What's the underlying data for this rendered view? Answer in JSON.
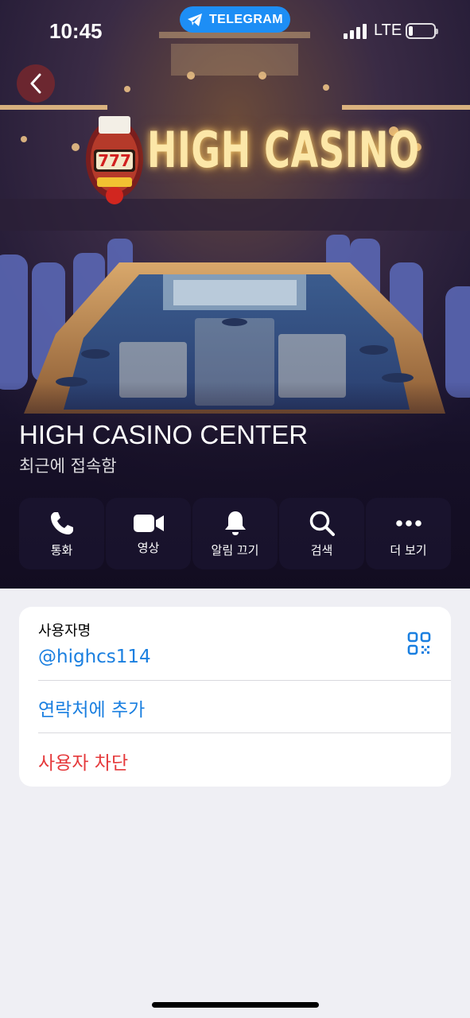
{
  "status_bar": {
    "time": "10:45",
    "app_pill": "TELEGRAM",
    "network": "LTE"
  },
  "banner": {
    "logo_text": "HIGH CASINO"
  },
  "profile": {
    "name": "HIGH CASINO CENTER",
    "status": "최근에 접속함"
  },
  "actions": [
    {
      "label": "통화",
      "icon": "phone-icon"
    },
    {
      "label": "영상",
      "icon": "video-icon"
    },
    {
      "label": "알림 끄기",
      "icon": "bell-icon"
    },
    {
      "label": "검색",
      "icon": "search-icon"
    },
    {
      "label": "더 보기",
      "icon": "more-icon"
    }
  ],
  "info": {
    "username_caption": "사용자명",
    "username": "@highcs114",
    "add_contact": "연락처에 추가",
    "block_user": "사용자 차단"
  },
  "colors": {
    "link": "#1a7fe0",
    "danger": "#e5393b",
    "pill": "#1d8ef5",
    "background": "#efeff4"
  }
}
